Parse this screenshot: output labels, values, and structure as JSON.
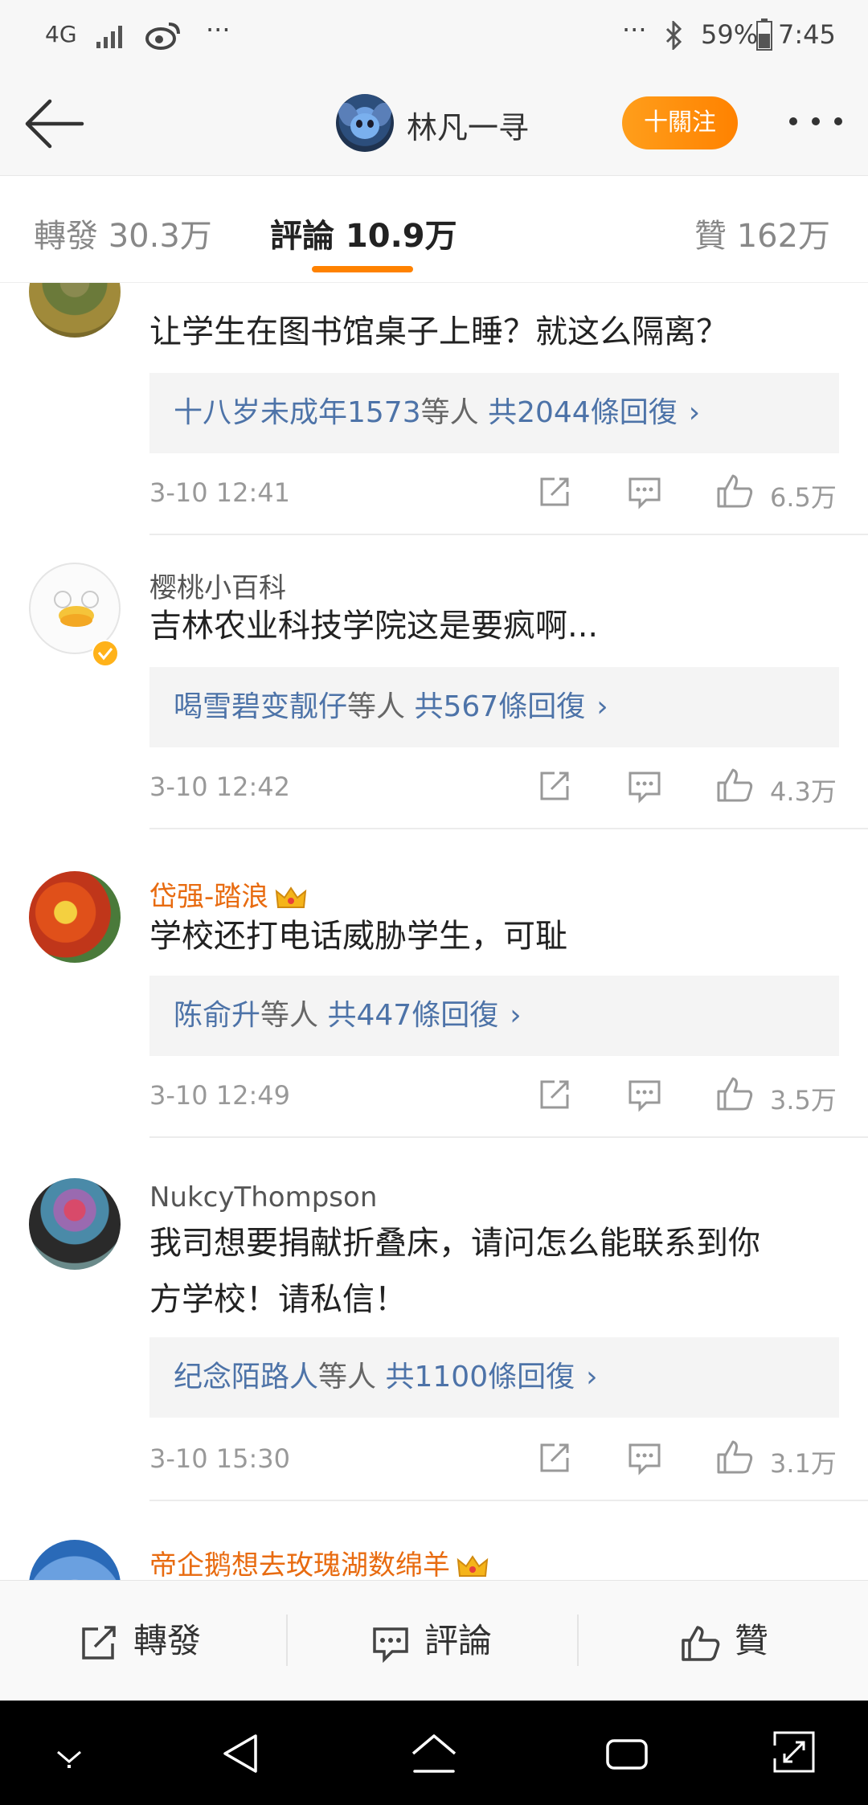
{
  "status_bar": {
    "network": "4G",
    "ellipsis_left": "···",
    "ellipsis_right": "···",
    "battery": "59%",
    "time": "7:45"
  },
  "header": {
    "user_name": "林凡一寻",
    "follow_label": "十關注"
  },
  "tabs": {
    "repost": "轉發 30.3万",
    "comment": "評論 10.9万",
    "like": "贊 162万"
  },
  "comments": [
    {
      "username": "",
      "text": "让学生在图书馆桌子上睡？就这么隔离？",
      "reply_names": "十八岁未成年1573",
      "reply_mid": "等人",
      "reply_total": "共2044條回復",
      "time": "3-10 12:41",
      "likes": "6.5万"
    },
    {
      "username": "樱桃小百科",
      "text": "吉林农业科技学院这是要疯啊...",
      "reply_names": "喝雪碧变靓仔",
      "reply_mid": "等人",
      "reply_total": "共567條回復",
      "time": "3-10 12:42",
      "likes": "4.3万"
    },
    {
      "username": "岱强-踏浪",
      "text": "学校还打电话威胁学生，可耻",
      "reply_names": "陈俞升",
      "reply_mid": "等人",
      "reply_total": "共447條回復",
      "time": "3-10 12:49",
      "likes": "3.5万"
    },
    {
      "username": "NukcyThompson",
      "text_line1": "我司想要捐献折叠床，请问怎么能联系到你",
      "text_line2": "方学校！请私信！",
      "reply_names": "纪念陌路人",
      "reply_mid": "等人",
      "reply_total": "共1100條回復",
      "time": "3-10 15:30",
      "likes": "3.1万"
    },
    {
      "username": "帝企鹅想去玫瑰湖数绵羊"
    }
  ],
  "bottom_bar": {
    "repost": "轉發",
    "comment": "評論",
    "like": "贊"
  },
  "colors": {
    "accent_orange": "#ff8200",
    "link_blue": "#4d73a8",
    "vip_orange": "#e86b10"
  }
}
